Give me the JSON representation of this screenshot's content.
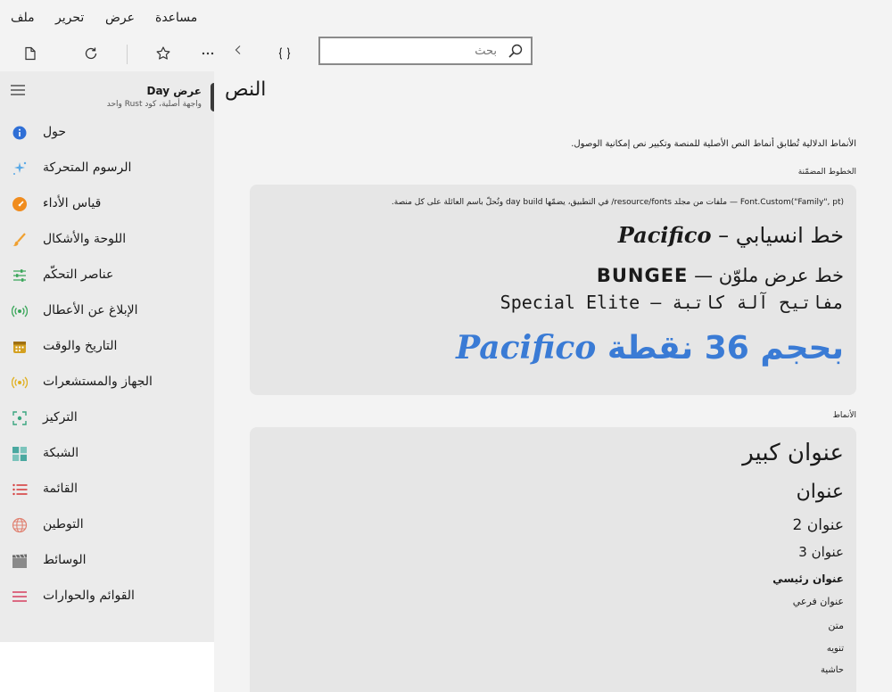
{
  "menu": [
    "ملف",
    "تحرير",
    "عرض",
    "مساعدة"
  ],
  "search": {
    "placeholder": "بحث"
  },
  "sidebar": {
    "app_title": "عرض Day",
    "app_subtitle": "واجهة أصلية، كود Rust واحد",
    "items": [
      {
        "label": "حول",
        "icon": "info-icon",
        "color": "#2f6fd6"
      },
      {
        "label": "الرسوم المتحركة",
        "icon": "sparkle-icon",
        "color": "#5aa9e6"
      },
      {
        "label": "قياس الأداء",
        "icon": "gauge-icon",
        "color": "#f08c1e"
      },
      {
        "label": "اللوحة والأشكال",
        "icon": "brush-icon",
        "color": "#f0a030"
      },
      {
        "label": "عناصر التحكّم",
        "icon": "sliders-icon",
        "color": "#3aa65a"
      },
      {
        "label": "الإبلاغ عن الأعطال",
        "icon": "broadcast-icon",
        "color": "#3aa65a"
      },
      {
        "label": "التاريخ والوقت",
        "icon": "calendar-icon",
        "color": "#d4a020"
      },
      {
        "label": "الجهاز والمستشعرات",
        "icon": "sensor-icon",
        "color": "#e0b020"
      },
      {
        "label": "التركيز",
        "icon": "focus-icon",
        "color": "#3aa680"
      },
      {
        "label": "الشبكة",
        "icon": "grid-icon",
        "color": "#4aa8a0"
      },
      {
        "label": "القائمة",
        "icon": "list-icon",
        "color": "#d64040"
      },
      {
        "label": "التوطين",
        "icon": "globe-icon",
        "color": "#e08070"
      },
      {
        "label": "الوسائط",
        "icon": "clapper-icon",
        "color": "#8a8a8a"
      },
      {
        "label": "القوائم والحوارات",
        "icon": "menu-lines-icon",
        "color": "#d64060"
      }
    ]
  },
  "main": {
    "title": "النص",
    "intro": "الأنماط الدلالية تُطابق أنماط النص الأصلية للمنصة وتكبير نص إمكانية الوصول.",
    "embedded_label": "الخطوط المضمّنة",
    "embedded_note": "Font.Custom(\"Family\", pt) — ملفات من مجلد resource/fonts/ في التطبيق، يضمّها day build وتُحلّ باسم العائلة على كل منصة.",
    "font_lines": {
      "line1_text": "خط انسيابي – ",
      "line1_brand": "Pacifico",
      "line2_text": "خط عرض ملوّن — ",
      "line2_brand": "BUNGEE",
      "line3_text": "مفاتيح آلة كاتبة — ",
      "line3_brand": "Special Elite",
      "line4_text": "بحجم 36 نقطة ",
      "line4_brand": "Pacifico"
    },
    "styles_label": "الأنماط",
    "styles": [
      "عنوان كبير",
      "عنوان",
      "عنوان 2",
      "عنوان 3",
      "عنوان رئيسي",
      "عنوان فرعي",
      "متن",
      "تنويه",
      "حاشية"
    ]
  }
}
